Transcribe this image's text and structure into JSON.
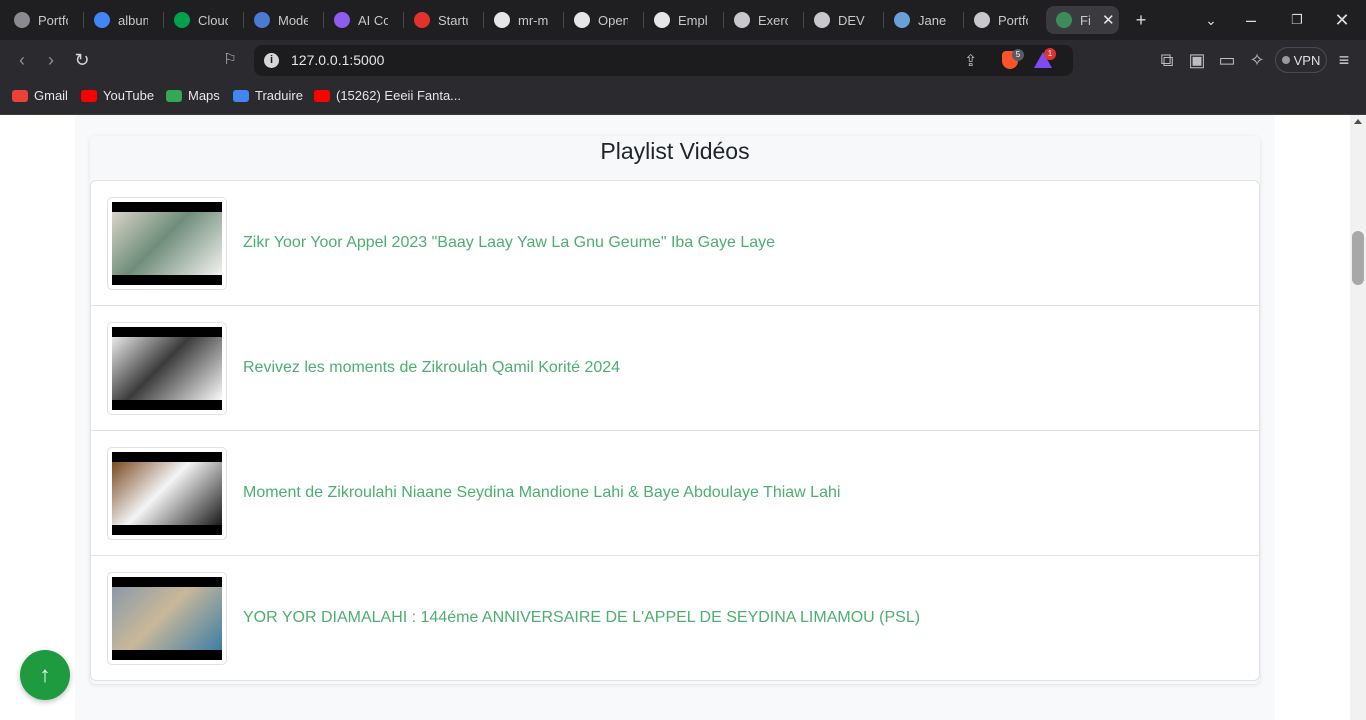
{
  "browser": {
    "tabs": [
      {
        "title": "Portfolio",
        "icon": "portfolio-icon",
        "color": "#8a8a90"
      },
      {
        "title": "album",
        "icon": "google-icon",
        "color": "#4285f4"
      },
      {
        "title": "Cloud",
        "icon": "mongodb-leaf-icon",
        "color": "#00a14b"
      },
      {
        "title": "Mode",
        "icon": "doc-icon",
        "color": "#4a7bd1"
      },
      {
        "title": "AI Co",
        "icon": "ai-icon",
        "color": "#8f5cf0"
      },
      {
        "title": "Startu",
        "icon": "startup-icon",
        "color": "#e2322d"
      },
      {
        "title": "mr-m",
        "icon": "github-icon",
        "color": "#e6e6e8"
      },
      {
        "title": "Open",
        "icon": "github-icon",
        "color": "#e6e6e8"
      },
      {
        "title": "Emplo",
        "icon": "info-icon",
        "color": "#e6e6e8"
      },
      {
        "title": "Exerci",
        "icon": "shield-icon",
        "color": "#c8c8cc"
      },
      {
        "title": "DEV C",
        "icon": "dev-icon",
        "color": "#c8c8cc"
      },
      {
        "title": "Jane C",
        "icon": "laptop-icon",
        "color": "#6aa0d8"
      },
      {
        "title": "Portfo",
        "icon": "globe-icon",
        "color": "#c8c8cc"
      },
      {
        "title": "Fi",
        "icon": "app-icon",
        "color": "#3e8a5a"
      }
    ],
    "active_tab_index": 13,
    "url": "127.0.0.1:5000",
    "shields_badge": "5",
    "rewards_badge": "1",
    "vpn_label": "VPN",
    "bookmarks": [
      {
        "label": "Gmail",
        "icon": "gmail-icon",
        "color": "#ea4335"
      },
      {
        "label": "YouTube",
        "icon": "youtube-icon",
        "color": "#ff0000"
      },
      {
        "label": "Maps",
        "icon": "maps-icon",
        "color": "#34a853"
      },
      {
        "label": "Traduire",
        "icon": "translate-icon",
        "color": "#4285f4"
      },
      {
        "label": "(15262) Eeeii Fanta...",
        "icon": "youtube-icon",
        "color": "#ff0000"
      }
    ]
  },
  "page": {
    "title": "Playlist Vidéos",
    "videos": [
      {
        "title": "Zikr Yoor Yoor Appel 2023 \"Baay Laay Yaw La Gnu Geume\" Iba Gaye Laye",
        "thumb_colors": [
          "#d8d4c8",
          "#6f8d7a",
          "#f2f2f0"
        ]
      },
      {
        "title": "Revivez les moments de Zikroulah Qamil Korité 2024",
        "thumb_colors": [
          "#e9e9e9",
          "#3b3b3b",
          "#fafafa"
        ]
      },
      {
        "title": "Moment de Zikroulahi Niaane Seydina Mandione Lahi & Baye Abdoulaye Thiaw Lahi",
        "thumb_colors": [
          "#7a4a22",
          "#f4f4f4",
          "#1a1a1a"
        ]
      },
      {
        "title": "YOR YOR DIAMALAHI : 144éme ANNIVERSAIRE DE L'APPEL DE SEYDINA LIMAMOU (PSL)",
        "thumb_colors": [
          "#8a9aa8",
          "#c9b89a",
          "#3d7ea6"
        ]
      }
    ],
    "back_to_top_icon": "arrow-up-icon"
  }
}
